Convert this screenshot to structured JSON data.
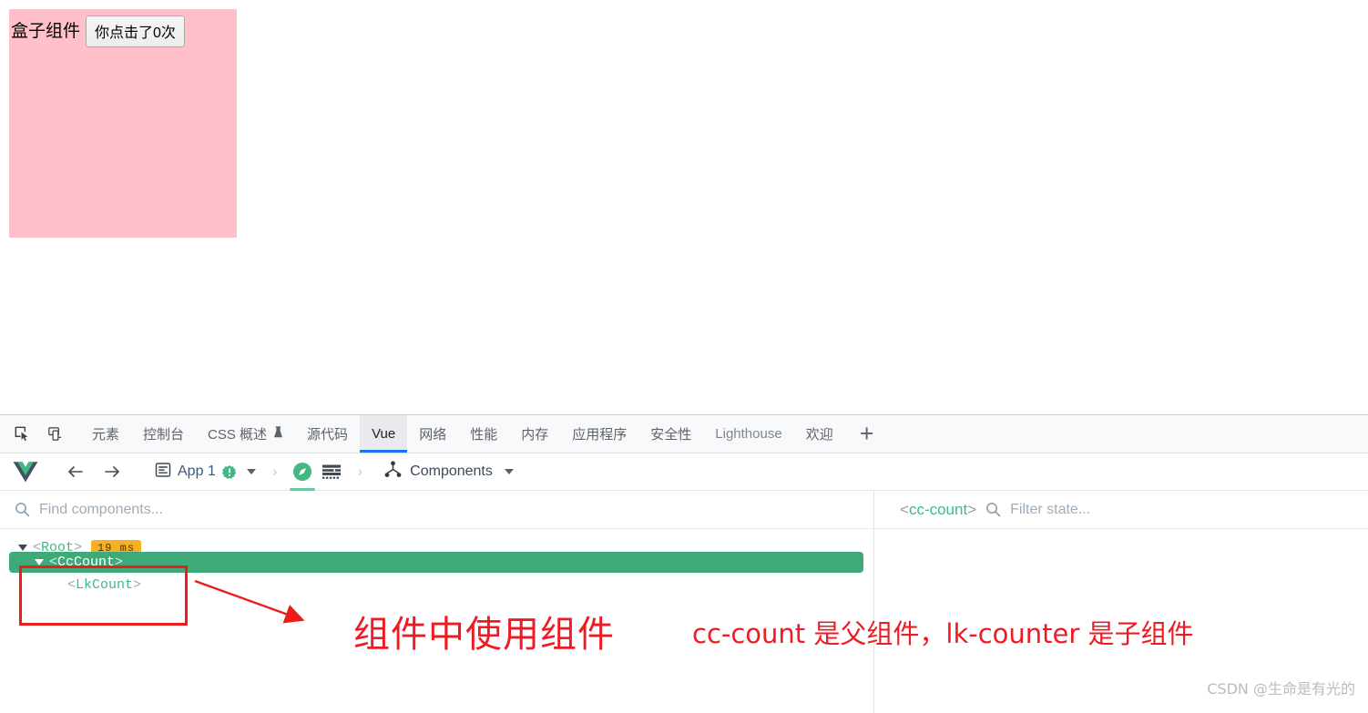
{
  "page": {
    "box_title": "盒子组件",
    "count_button_label": "你点击了0次",
    "box_color": "#ffc0cb"
  },
  "devtools": {
    "tabs": [
      {
        "label": "元素",
        "active": false
      },
      {
        "label": "控制台",
        "active": false
      },
      {
        "label": "CSS 概述",
        "active": false,
        "icon": "flask-icon"
      },
      {
        "label": "源代码",
        "active": false
      },
      {
        "label": "Vue",
        "active": true
      },
      {
        "label": "网络",
        "active": false
      },
      {
        "label": "性能",
        "active": false
      },
      {
        "label": "内存",
        "active": false
      },
      {
        "label": "应用程序",
        "active": false
      },
      {
        "label": "安全性",
        "active": false
      },
      {
        "label": "Lighthouse",
        "active": false
      },
      {
        "label": "欢迎",
        "active": false
      }
    ],
    "add_tab_label": "+",
    "inspect_icon": "inspect-element-icon",
    "device_icon": "device-toolbar-icon",
    "active_tab_accent": "#1a73e8"
  },
  "vue_toolbar": {
    "logo": "vue-logo-icon",
    "back_label": "←",
    "forward_label": "→",
    "app_label": "App 1",
    "app_icon": "app-window-icon",
    "warning_icon": "warning-badge-icon",
    "app_caret": "▾",
    "separator": "›",
    "route_icon": "compass-icon",
    "data_icon": "data-grid-icon",
    "mode_label": "Components",
    "mode_icon": "component-tree-icon",
    "mode_caret": "▾",
    "accent_green": "#42b883"
  },
  "left_pane": {
    "search_placeholder": "Find components...",
    "search_value": "",
    "search_icon": "search-icon",
    "tree": [
      {
        "name": "Root",
        "open_bracket": "<",
        "close_bracket": ">",
        "badge": "19 ms",
        "expanded": true,
        "selected": false,
        "depth": 0
      },
      {
        "name": "CcCount",
        "open_bracket": "<",
        "close_bracket": ">",
        "badge": "",
        "expanded": true,
        "selected": true,
        "depth": 1
      },
      {
        "name": "LkCount",
        "open_bracket": "<",
        "close_bracket": ">",
        "badge": "",
        "expanded": false,
        "selected": false,
        "depth": 2
      }
    ],
    "selected_highlight_color": "#3fa97a",
    "badge_color": "#f5b122"
  },
  "right_pane": {
    "selected_component_open": "<",
    "selected_component_name": "cc-count",
    "selected_component_close": ">",
    "filter_placeholder": "Filter state...",
    "filter_value": "",
    "filter_icon": "search-icon"
  },
  "annotations": {
    "rect_color": "#ee1b1b",
    "arrow_icon": "red-arrow-icon",
    "text_main": "组件中使用组件",
    "text_detail": "cc-count 是父组件，lk-counter 是子组件",
    "text_color": "#ee1b24"
  },
  "watermark": {
    "text": "CSDN @生命是有光的"
  }
}
